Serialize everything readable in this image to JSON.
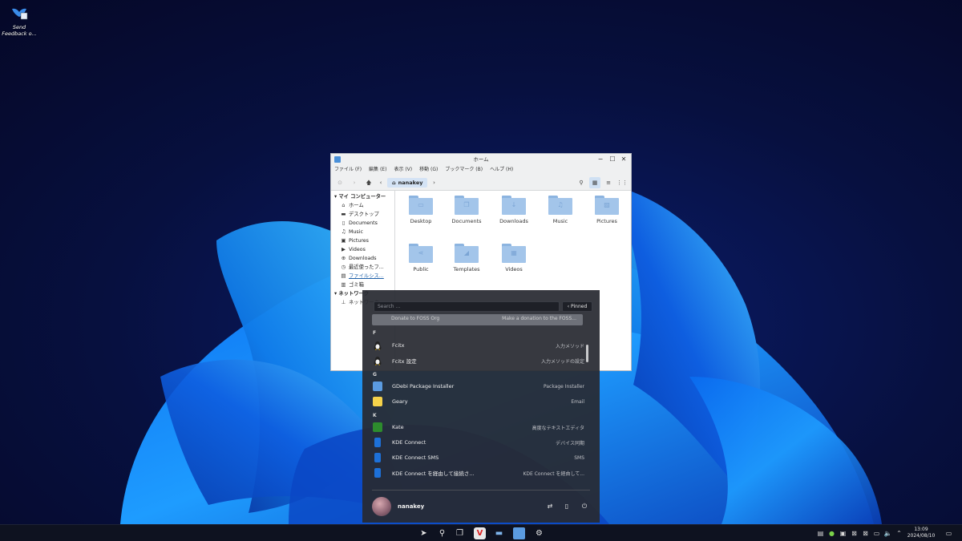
{
  "desktop": {
    "icon_label": "Send Feedback o..."
  },
  "file_manager": {
    "title": "ホーム",
    "menu": [
      "ファイル (F)",
      "編集 (E)",
      "表示 (V)",
      "移動 (G)",
      "ブックマーク (B)",
      "ヘルプ (H)"
    ],
    "breadcrumb": "nanakey",
    "sidebar": {
      "computer_header": "マイ コンピューター",
      "items": [
        {
          "icon": "home-icon",
          "label": "ホーム"
        },
        {
          "icon": "desktop-folder-icon",
          "label": "デスクトップ"
        },
        {
          "icon": "document-icon",
          "label": "Documents"
        },
        {
          "icon": "music-icon",
          "label": "Music"
        },
        {
          "icon": "pictures-icon",
          "label": "Pictures"
        },
        {
          "icon": "video-icon",
          "label": "Videos"
        },
        {
          "icon": "download-icon",
          "label": "Downloads"
        },
        {
          "icon": "recent-icon",
          "label": "最近使ったフ..."
        },
        {
          "icon": "filesystem-icon",
          "label": "ファイルシス..."
        },
        {
          "icon": "trash-icon",
          "label": "ゴミ箱"
        }
      ],
      "network_header": "ネットワーク",
      "network_items": [
        {
          "icon": "network-icon",
          "label": "ネットワーク"
        }
      ]
    },
    "folders": [
      {
        "name": "Desktop",
        "emblem": "desktop-emblem-icon"
      },
      {
        "name": "Documents",
        "emblem": "documents-emblem-icon"
      },
      {
        "name": "Downloads",
        "emblem": "download-emblem-icon"
      },
      {
        "name": "Music",
        "emblem": "music-emblem-icon"
      },
      {
        "name": "Pictures",
        "emblem": "pictures-emblem-icon"
      },
      {
        "name": "Public",
        "emblem": "share-emblem-icon"
      },
      {
        "name": "Templates",
        "emblem": "templates-emblem-icon"
      },
      {
        "name": "Videos",
        "emblem": "video-emblem-icon"
      }
    ]
  },
  "launcher": {
    "search_placeholder": "Search ...",
    "pinned_label": "Pinned",
    "partial_row": {
      "name": "Donate to FOSS Org",
      "desc": "Make a donation to the FOSS..."
    },
    "sections": [
      {
        "letter": "F",
        "apps": [
          {
            "name": "Fcitx",
            "desc": "入力メソッド",
            "icon": "fcitx-penguin-icon"
          },
          {
            "name": "Fcitx 設定",
            "desc": "入力メソッドの設定",
            "icon": "fcitx-penguin-icon"
          }
        ]
      },
      {
        "letter": "G",
        "apps": [
          {
            "name": "GDebi Package Installer",
            "desc": "Package Installer",
            "icon": "gdebi-icon"
          },
          {
            "name": "Geary",
            "desc": "Email",
            "icon": "geary-icon"
          }
        ]
      },
      {
        "letter": "K",
        "apps": [
          {
            "name": "Kate",
            "desc": "高度なテキストエディタ",
            "icon": "kate-icon"
          },
          {
            "name": "KDE Connect",
            "desc": "デバイス同期",
            "icon": "kdeconnect-icon"
          },
          {
            "name": "KDE Connect SMS",
            "desc": "SMS",
            "icon": "kdeconnect-icon"
          },
          {
            "name": "KDE Connect を経由して接続さ...",
            "desc": "KDE Connect を経由して...",
            "icon": "kdeconnect-icon"
          }
        ]
      }
    ],
    "user_name": "nanakey"
  },
  "taskbar": {
    "clock_time": "13:09",
    "clock_date": "2024/08/10"
  },
  "colors": {
    "accent": "#1d5fa8",
    "folder": "#a3c5ea",
    "launcher_bg": "#282a32",
    "taskbar_bg": "#0e1220"
  }
}
